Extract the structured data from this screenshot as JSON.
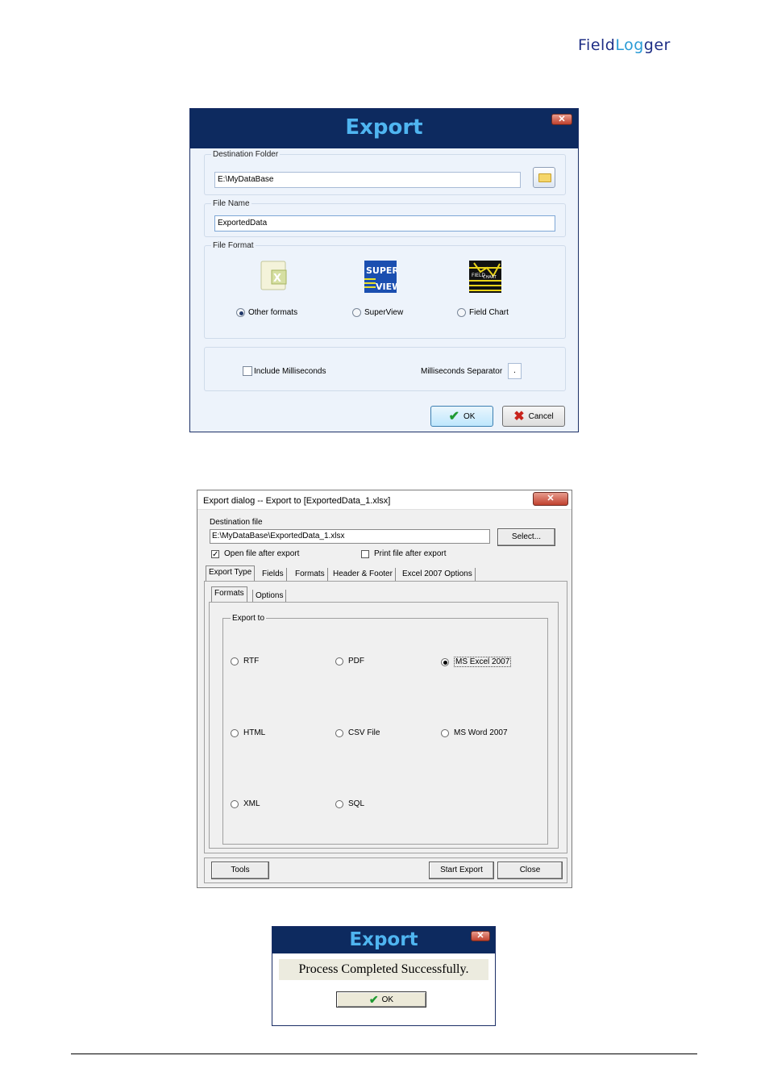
{
  "logo": {
    "part1": "Field",
    "part2": "Log",
    "part3": "ger"
  },
  "dialog1": {
    "title": "Export",
    "close_glyph": "✕",
    "destination_label": "Destination Folder",
    "destination_value": "E:\\MyDataBase",
    "filename_label": "File Name",
    "filename_value": "ExportedData",
    "format_label": "File Format",
    "formats": [
      {
        "label": "Other formats",
        "icon": "excel-icon",
        "selected": true
      },
      {
        "label": "SuperView",
        "icon": "superview-icon",
        "selected": false
      },
      {
        "label": "Field Chart",
        "icon": "fieldchart-icon",
        "selected": false
      }
    ],
    "include_ms_label": "Include Milliseconds",
    "ms_separator_label": "Milliseconds Separator",
    "ms_separator_value": ".",
    "ok_label": "OK",
    "cancel_label": "Cancel",
    "colors": {
      "title_bar": "#0d2a5f",
      "title_text": "#4fb5f0",
      "body": "#edf3fb"
    }
  },
  "dialog2": {
    "title": "Export dialog -- Export to [ExportedData_1.xlsx]",
    "close_glyph": "✕",
    "dest_label": "Destination file",
    "dest_value": "E:\\MyDataBase\\ExportedData_1.xlsx",
    "select_label": "Select...",
    "open_after_label": "Open file after export",
    "open_after_checked": "✓",
    "print_after_label": "Print file after export",
    "tabs": [
      "Export Type",
      "Fields",
      "Formats",
      "Header & Footer",
      "Excel 2007 Options"
    ],
    "subtabs": [
      "Formats",
      "Options"
    ],
    "group_label": "Export to",
    "options": [
      "RTF",
      "PDF",
      "MS Excel 2007",
      "HTML",
      "CSV File",
      "MS Word 2007",
      "XML",
      "SQL"
    ],
    "tools_label": "Tools",
    "start_label": "Start Export",
    "close_label": "Close"
  },
  "dialog3": {
    "title": "Export",
    "close_glyph": "✕",
    "message": "Process Completed Successfully.",
    "ok_label": "OK"
  }
}
